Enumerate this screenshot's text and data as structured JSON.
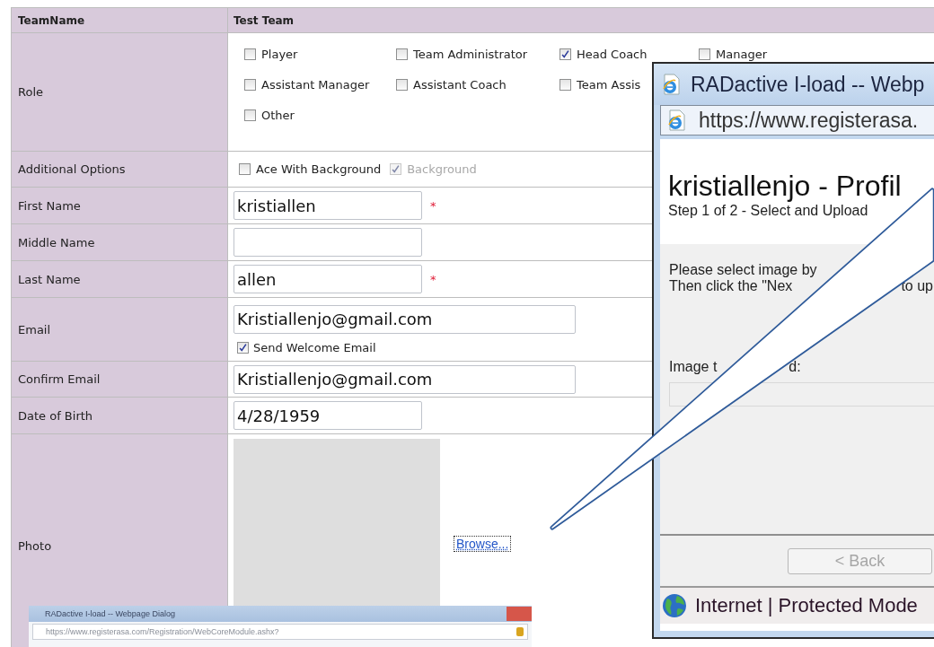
{
  "header": {
    "label": "TeamName",
    "value": "Test Team"
  },
  "rows": [
    {
      "kind": "roles",
      "label": "Role",
      "options": [
        [
          {
            "label": "Player",
            "checked": false
          },
          {
            "label": "Team Administrator",
            "checked": false
          },
          {
            "label": "Head Coach",
            "checked": true
          },
          {
            "label": "Manager",
            "checked": false
          }
        ],
        [
          {
            "label": "Assistant Manager",
            "checked": false
          },
          {
            "label": "Assistant Coach",
            "checked": false
          },
          {
            "label": "Team Assis",
            "checked": false
          }
        ],
        [
          {
            "label": "Other",
            "checked": false
          }
        ]
      ]
    },
    {
      "kind": "options",
      "label": "Additional Options",
      "options": [
        {
          "label": "Ace With Background",
          "checked": false,
          "disabled": false
        },
        {
          "label": "Background",
          "checked": true,
          "disabled": true
        }
      ]
    },
    {
      "kind": "short-field",
      "label": "First Name",
      "value": "kristiallen",
      "required_mark": "*"
    },
    {
      "kind": "short-field",
      "label": "Middle Name"
    },
    {
      "kind": "short-field",
      "label": "Last Name",
      "value": "allen",
      "required_mark": "*"
    },
    {
      "kind": "long-field",
      "label": "Email",
      "value": "Kristiallenjo@gmail.com",
      "welcome": {
        "label": "Send Welcome Email",
        "checked": true
      }
    },
    {
      "kind": "long-field",
      "label": "Confirm Email",
      "value": "Kristiallenjo@gmail.com"
    },
    {
      "kind": "short-field",
      "label": "Date of Birth",
      "value": "4/28/1959"
    },
    {
      "kind": "photo",
      "label": "Photo",
      "link": "Browse..."
    }
  ],
  "dialog": {
    "title": "RADactive I-load -- Webp",
    "address": "https://www.registerasa.",
    "heading": "kristiallenjo - Profil",
    "step": "Step 1 of 2 - Select and Upload",
    "instructions": [
      [
        "Please select image by"
      ],
      [
        "Then click the \"Nex",
        "to up"
      ]
    ],
    "image_label": [
      "Image t",
      "d:"
    ],
    "back_button": {
      "label": "< Back",
      "disabled": true
    },
    "status": "Internet | Protected Mode"
  },
  "thumbnail": {
    "title": "RADactive I-load -- Webpage Dialog",
    "address": "https://www.registerasa.com/Registration/WebCoreModule.ashx?"
  }
}
